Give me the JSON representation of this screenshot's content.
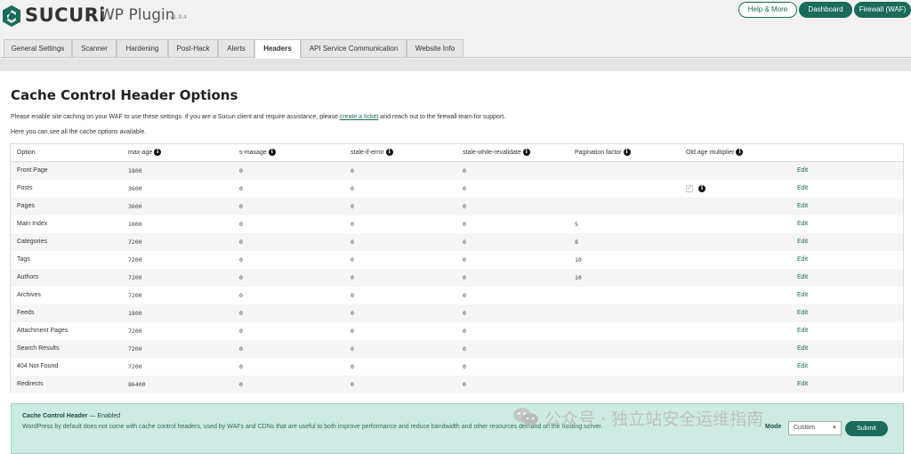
{
  "app": {
    "brand": "SUCURi",
    "product": "WP Plugin",
    "version": "v1.9.4",
    "buttons": [
      "Help & More",
      "Dashboard",
      "Firewall (WAF)"
    ]
  },
  "tabs": [
    {
      "label": "General Settings",
      "active": false
    },
    {
      "label": "Scanner",
      "active": false
    },
    {
      "label": "Hardening",
      "active": false
    },
    {
      "label": "Post-Hack",
      "active": false
    },
    {
      "label": "Alerts",
      "active": false
    },
    {
      "label": "Headers",
      "active": true
    },
    {
      "label": "API Service Communication",
      "active": false
    },
    {
      "label": "Website Info",
      "active": false
    }
  ],
  "page": {
    "title": "Cache Control Header Options",
    "desc_before": "Please enable site caching on your WAF to use these settings. If you are a Sucuri client and require assistance, please ",
    "desc_link": "create a ticket",
    "desc_after": " and reach out to the firewall team for support.",
    "desc2": "Here you can see all the cache options available."
  },
  "table": {
    "headers": [
      "Option",
      "max-age",
      "s-maxage",
      "stale-if-error",
      "stale-while-revalidate",
      "Pagination factor",
      "Old age multiplier"
    ],
    "info_on": [
      false,
      true,
      true,
      true,
      true,
      true,
      true
    ],
    "edit_label": "Edit",
    "rows": [
      {
        "option": "Front Page",
        "max_age": "1800",
        "s_maxage": "0",
        "stale_if_error": "0",
        "stale_while_revalidate": "0",
        "pagination": "",
        "old_age": false
      },
      {
        "option": "Posts",
        "max_age": "3600",
        "s_maxage": "0",
        "stale_if_error": "0",
        "stale_while_revalidate": "0",
        "pagination": "",
        "old_age": true
      },
      {
        "option": "Pages",
        "max_age": "3600",
        "s_maxage": "0",
        "stale_if_error": "0",
        "stale_while_revalidate": "0",
        "pagination": "",
        "old_age": false
      },
      {
        "option": "Main Index",
        "max_age": "1800",
        "s_maxage": "0",
        "stale_if_error": "0",
        "stale_while_revalidate": "0",
        "pagination": "5",
        "old_age": false
      },
      {
        "option": "Categories",
        "max_age": "7200",
        "s_maxage": "0",
        "stale_if_error": "0",
        "stale_while_revalidate": "0",
        "pagination": "8",
        "old_age": false
      },
      {
        "option": "Tags",
        "max_age": "7200",
        "s_maxage": "0",
        "stale_if_error": "0",
        "stale_while_revalidate": "0",
        "pagination": "10",
        "old_age": false
      },
      {
        "option": "Authors",
        "max_age": "7200",
        "s_maxage": "0",
        "stale_if_error": "0",
        "stale_while_revalidate": "0",
        "pagination": "10",
        "old_age": false
      },
      {
        "option": "Archives",
        "max_age": "7200",
        "s_maxage": "0",
        "stale_if_error": "0",
        "stale_while_revalidate": "0",
        "pagination": "",
        "old_age": false
      },
      {
        "option": "Feeds",
        "max_age": "1800",
        "s_maxage": "0",
        "stale_if_error": "0",
        "stale_while_revalidate": "0",
        "pagination": "",
        "old_age": false
      },
      {
        "option": "Attachment Pages",
        "max_age": "7200",
        "s_maxage": "0",
        "stale_if_error": "0",
        "stale_while_revalidate": "0",
        "pagination": "",
        "old_age": false
      },
      {
        "option": "Search Results",
        "max_age": "7200",
        "s_maxage": "0",
        "stale_if_error": "0",
        "stale_while_revalidate": "0",
        "pagination": "",
        "old_age": false
      },
      {
        "option": "404 Not Found",
        "max_age": "7200",
        "s_maxage": "0",
        "stale_if_error": "0",
        "stale_while_revalidate": "0",
        "pagination": "",
        "old_age": false
      },
      {
        "option": "Redirects",
        "max_age": "86400",
        "s_maxage": "0",
        "stale_if_error": "0",
        "stale_while_revalidate": "0",
        "pagination": "",
        "old_age": false
      }
    ]
  },
  "panel": {
    "title": "Cache Control Header",
    "status": " — Enabled",
    "text": "WordPress by default does not come with cache control headers, used by WAFs and CDNs that are useful to both improve performance and reduce bandwidth and other resources demand on the hosting server.",
    "mode_label": "Mode",
    "mode_value": "Custom",
    "submit_label": "Submit"
  },
  "watermark": {
    "text": "公众号 · 独立站安全运维指南"
  },
  "colors": {
    "accent": "#1a6b5a",
    "panel_bg": "#cdebe2"
  },
  "icons": {
    "info": "info-icon",
    "logo": "sucuri-logo-icon",
    "check": "check-icon",
    "chevron": "chevron-down-icon",
    "wechat": "wechat-icon"
  }
}
